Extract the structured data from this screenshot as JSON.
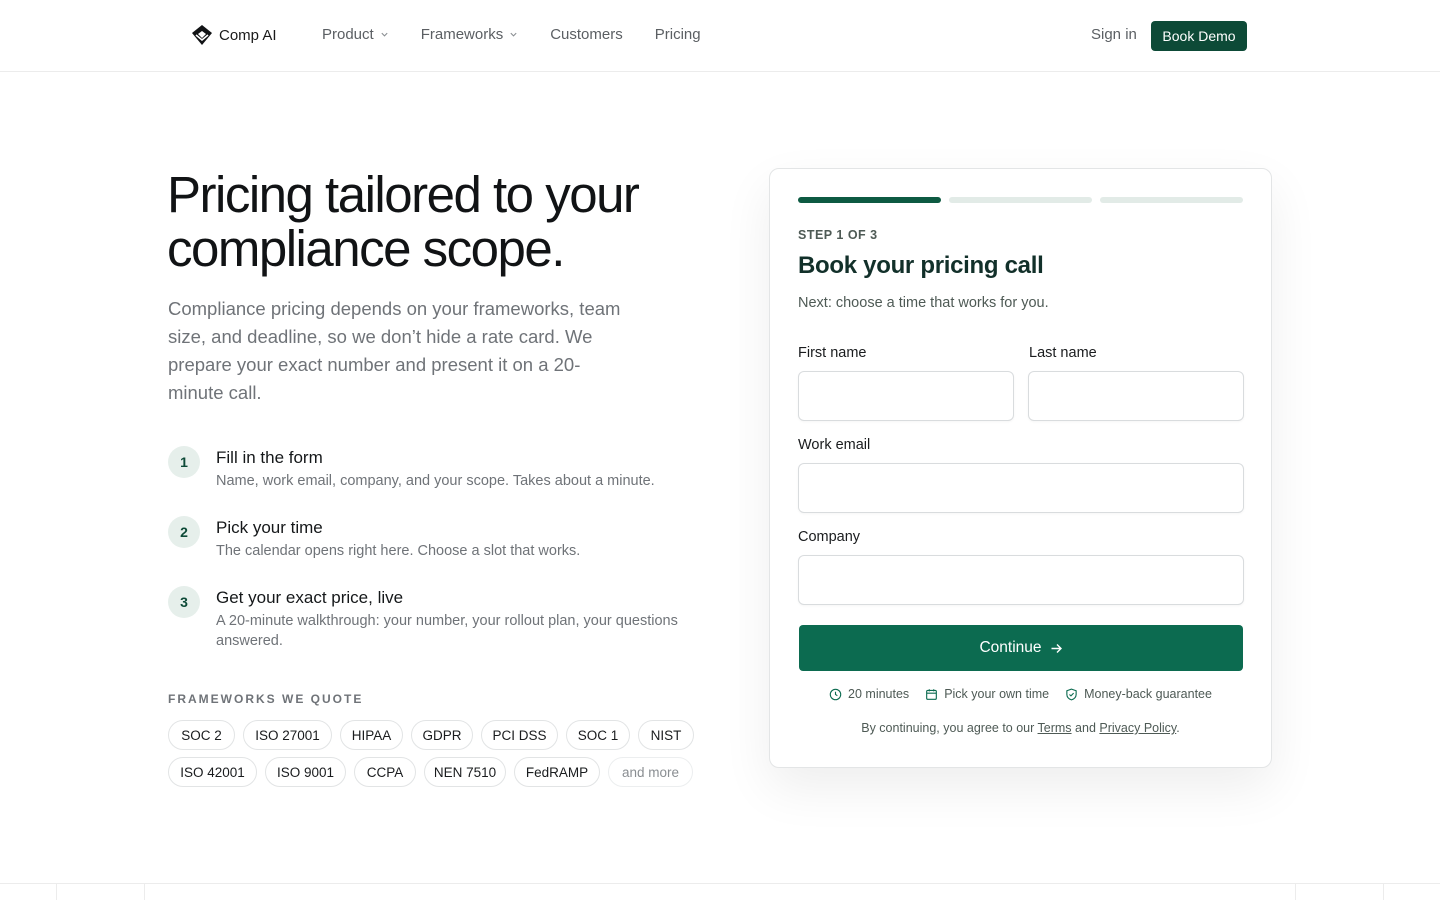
{
  "brand": {
    "name": "Comp AI",
    "accent": "#0d4a37",
    "button_green": "#0c6b50"
  },
  "nav": {
    "items": [
      {
        "label": "Product",
        "has_dropdown": true
      },
      {
        "label": "Frameworks",
        "has_dropdown": true
      },
      {
        "label": "Customers",
        "has_dropdown": false
      },
      {
        "label": "Pricing",
        "has_dropdown": false
      }
    ],
    "sign_in": "Sign in",
    "book_demo": "Book Demo"
  },
  "hero": {
    "headline": "Pricing tailored to your compliance scope.",
    "lede": "Compliance pricing depends on your frameworks, team size, and deadline, so we don’t hide a rate card. We prepare your exact number and present it on a 20-minute call."
  },
  "steps": [
    {
      "num": "1",
      "title": "Fill in the form",
      "desc": "Name, work email, company, and your scope. Takes about a minute."
    },
    {
      "num": "2",
      "title": "Pick your time",
      "desc": "The calendar opens right here. Choose a slot that works."
    },
    {
      "num": "3",
      "title": "Get your exact price, live",
      "desc": "A 20-minute walkthrough: your number, your rollout plan, your questions answered."
    }
  ],
  "frameworks": {
    "label": "FRAMEWORKS WE QUOTE",
    "row1": [
      "SOC 2",
      "ISO 27001",
      "HIPAA",
      "GDPR",
      "PCI DSS",
      "SOC 1",
      "NIST"
    ],
    "row2": [
      "ISO 42001",
      "ISO 9001",
      "CCPA",
      "NEN 7510",
      "FedRAMP"
    ],
    "more": "and more"
  },
  "form": {
    "progress_current": 1,
    "progress_total": 3,
    "step_label": "STEP 1 OF 3",
    "title": "Book your pricing call",
    "subtitle": "Next: choose a time that works for you.",
    "first_name_label": "First name",
    "last_name_label": "Last name",
    "email_label": "Work email",
    "company_label": "Company",
    "first_name_value": "",
    "last_name_value": "",
    "email_value": "",
    "company_value": "",
    "continue_label": "Continue",
    "meta": [
      "20 minutes",
      "Pick your own time",
      "Money-back guarantee"
    ],
    "legal_prefix": "By continuing, you agree to our ",
    "legal_terms": "Terms",
    "legal_and": " and ",
    "legal_privacy": "Privacy Policy",
    "legal_suffix": "."
  }
}
